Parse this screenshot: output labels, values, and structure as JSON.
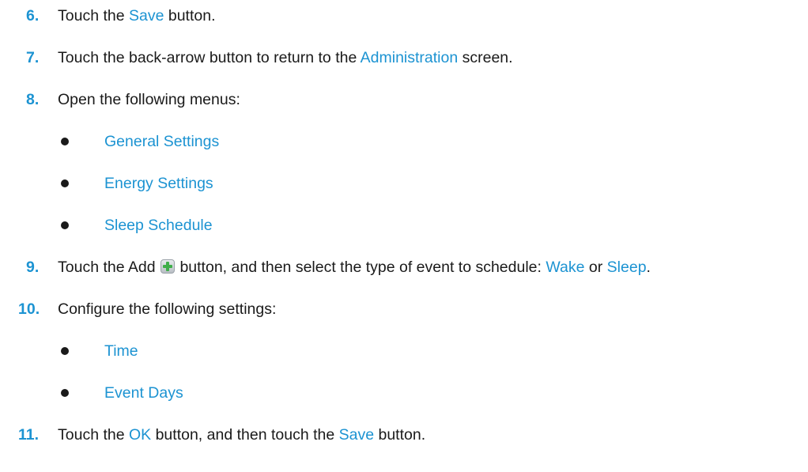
{
  "steps": [
    {
      "num": "6.",
      "pre": "Touch the ",
      "ui": "Save",
      "post": " button."
    },
    {
      "num": "7.",
      "pre": "Touch the back-arrow button to return to the ",
      "ui": "Administration",
      "post": " screen."
    },
    {
      "num": "8.",
      "text": "Open the following menus:",
      "bullets": [
        "General Settings",
        "Energy Settings",
        "Sleep Schedule"
      ]
    },
    {
      "num": "9.",
      "pre": "Touch the Add ",
      "icon": "add-icon",
      "mid": " button, and then select the type of event to schedule: ",
      "ui1": "Wake",
      "or": " or ",
      "ui2": "Sleep",
      "end": "."
    },
    {
      "num": "10.",
      "text": "Configure the following settings:",
      "bullets": [
        "Time",
        "Event Days"
      ]
    },
    {
      "num": "11.",
      "pre": "Touch the ",
      "ui1": "OK",
      "mid": " button, and then touch the ",
      "ui2": "Save",
      "end": " button."
    }
  ],
  "colors": {
    "accent": "#1c93d2",
    "text": "#1a1a1a"
  }
}
